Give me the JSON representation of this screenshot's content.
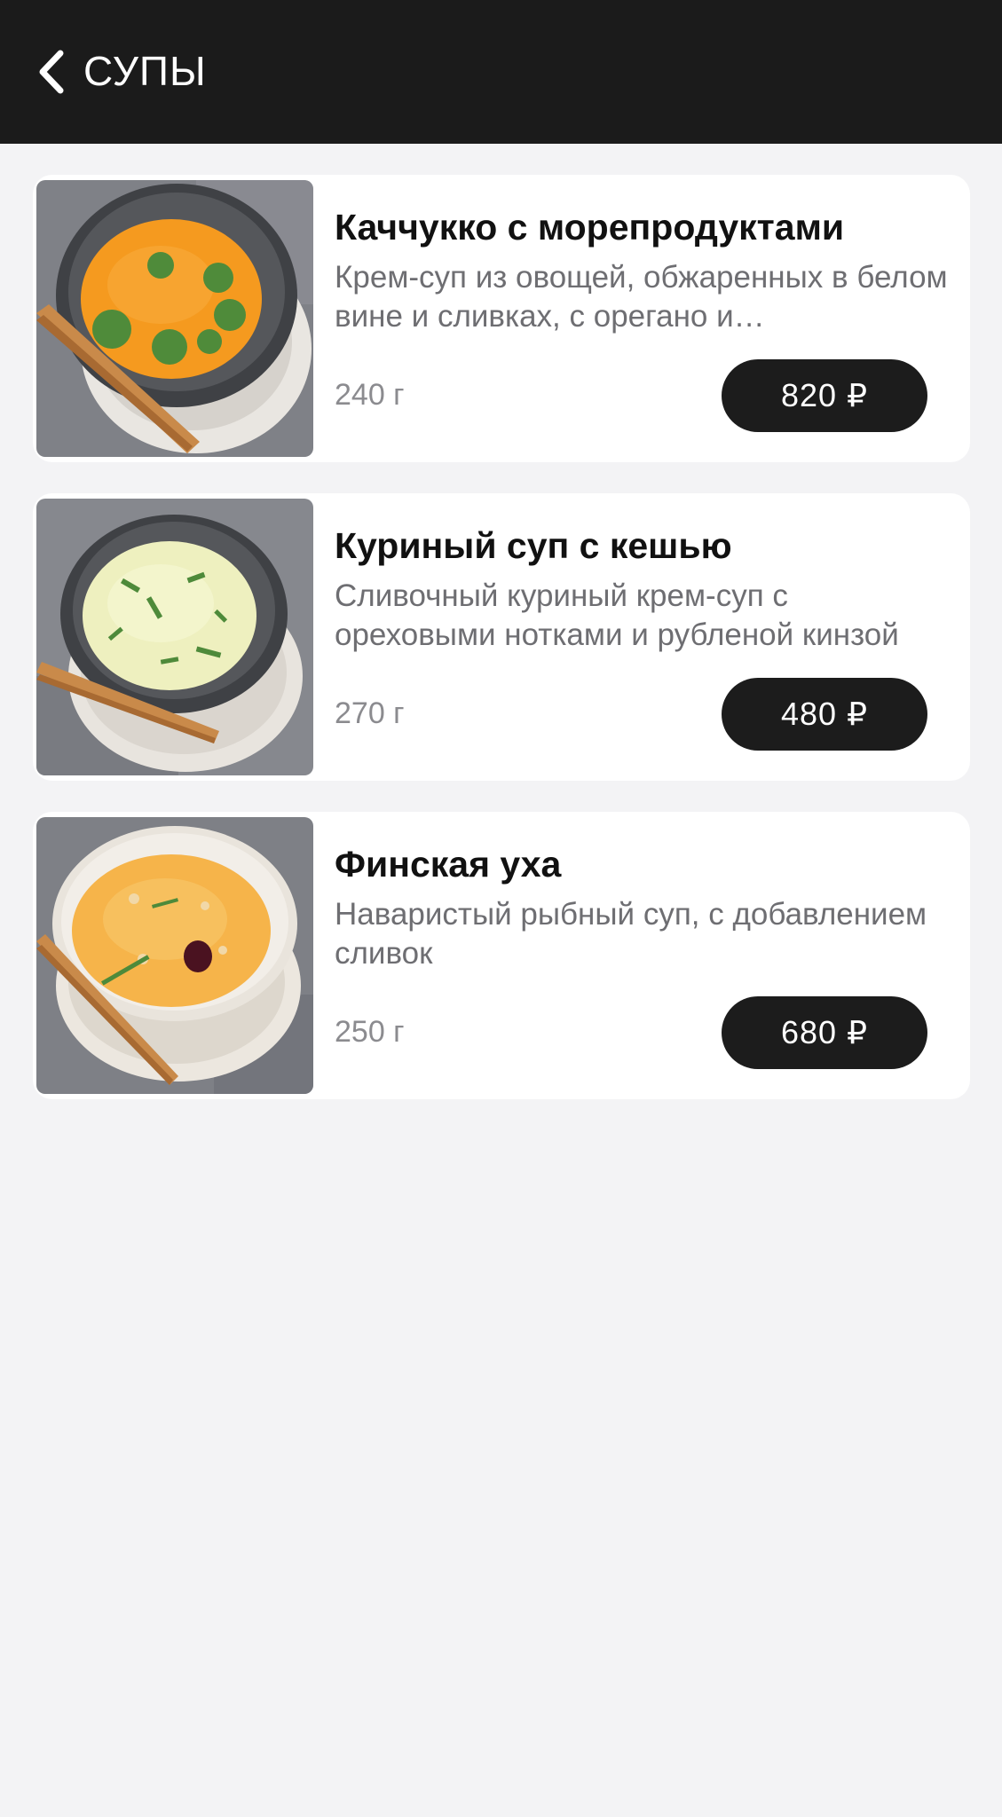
{
  "header": {
    "title": "СУПЫ",
    "back_icon": "chevron-left-icon",
    "background": "#1b1b1b"
  },
  "items": [
    {
      "name": "Каччукко с морепродуктами",
      "description": "Крем-суп из овощей, обжаренных в белом вине и сливках, с орегано и морепродуктами",
      "weight": "240 г",
      "price": "820 ₽",
      "image": "orange-soup-photo",
      "soup_color": "#f59a1f",
      "bowl_color": "#4a4c50"
    },
    {
      "name": "Куриный суп с кешью",
      "description": "Сливочный куриный крем-суп с ореховыми нотками и рубленой кинзой",
      "weight": "270 г",
      "price": "480 ₽",
      "image": "chicken-cream-soup-photo",
      "soup_color": "#eef0bf",
      "bowl_color": "#4a4c50"
    },
    {
      "name": "Финская уха",
      "description": "Наваристый рыбный суп, с добавлением сливок",
      "weight": "250 г",
      "price": "680 ₽",
      "image": "finnish-fish-soup-photo",
      "soup_color": "#f6b44a",
      "bowl_color": "#e9e4dc"
    }
  ]
}
